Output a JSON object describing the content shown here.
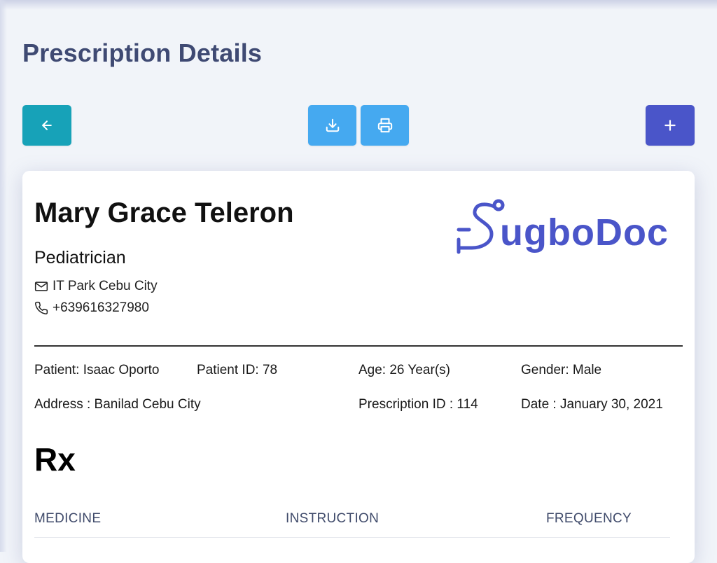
{
  "page": {
    "title": "Prescription Details"
  },
  "toolbar": {
    "back_icon": "arrow-left-icon",
    "download_icon": "download-icon",
    "print_icon": "printer-icon",
    "add_icon": "plus-icon",
    "colors": {
      "back": "#17a2b8",
      "download": "#45a9f0",
      "print": "#45a9f0",
      "add": "#4a55c9"
    }
  },
  "doctor": {
    "name": "Mary Grace Teleron",
    "specialty": "Pediatrician",
    "address": "IT Park Cebu City",
    "phone": "+639616327980"
  },
  "logo": {
    "text": "SugboDoc",
    "color": "#4a55c9"
  },
  "patient": {
    "name_label": "Patient: Isaac Oporto",
    "id_label": "Patient ID: 78",
    "age_label": "Age: 26 Year(s)",
    "gender_label": "Gender: Male",
    "address_label": "Address : Banilad Cebu City",
    "prescription_id_label": "Prescription ID : 114",
    "date_label": "Date : January 30, 2021"
  },
  "rx": {
    "symbol": "Rx",
    "columns": [
      "MEDICINE",
      "INSTRUCTION",
      "FREQUENCY"
    ]
  }
}
